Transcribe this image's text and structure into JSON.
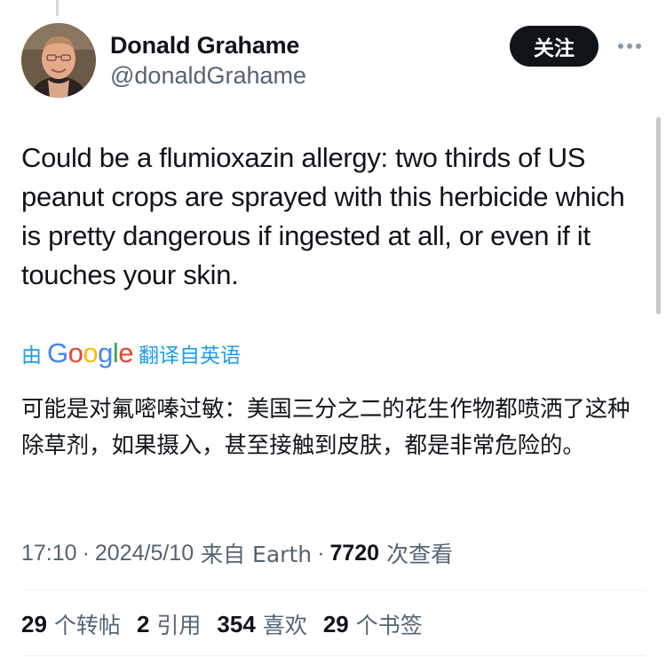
{
  "author": {
    "display_name": "Donald Grahame",
    "handle": "@donaldGrahame"
  },
  "actions": {
    "follow_label": "关注"
  },
  "tweet": {
    "text": "Could be a flumioxazin allergy: two thirds of US peanut crops are sprayed with this herbicide which is pretty dangerous if ingested at all, or even if it touches your skin.",
    "translation_prefix": "由",
    "translation_provider": "Google",
    "translation_suffix": "翻译自英语",
    "translated_text": "可能是对氟嘧嗪过敏：美国三分之二的花生作物都喷洒了这种除草剂，如果摄入，甚至接触到皮肤，都是非常危险的。"
  },
  "meta": {
    "time": "17:10",
    "separator": "·",
    "date": "2024/5/10",
    "source": "来自 Earth",
    "views_count": "7720",
    "views_label": "次查看"
  },
  "stats": [
    {
      "count": "29",
      "label": "个转帖"
    },
    {
      "count": "2",
      "label": "引用"
    },
    {
      "count": "354",
      "label": "喜欢"
    },
    {
      "count": "29",
      "label": "个书签"
    }
  ],
  "colors": {
    "link": "#1d9bf0",
    "secondary_text": "#536471",
    "primary_text": "#0f1419",
    "follow_button_bg": "#0f1419"
  }
}
